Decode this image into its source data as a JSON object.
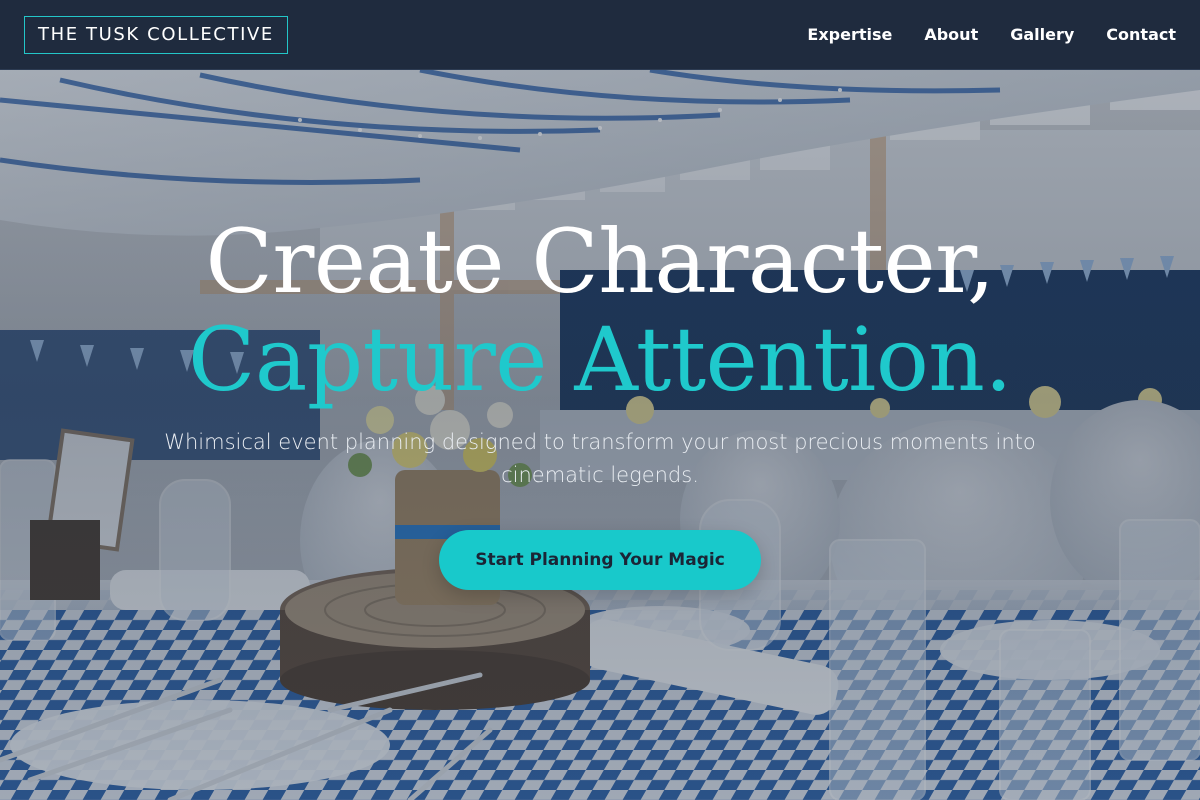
{
  "nav": {
    "brand": "THE TUSK COLLECTIVE",
    "links": [
      "Expertise",
      "About",
      "Gallery",
      "Contact"
    ]
  },
  "hero": {
    "headline_line1": "Create Character,",
    "headline_line2": "Capture Attention.",
    "subtitle": "Whimsical event planning designed to transform your most precious moments into cinematic legends.",
    "cta_label": "Start Planning Your Magic",
    "background_image": "decorated-banquet-hall-photo"
  },
  "colors": {
    "nav_background": "#1f2b3e",
    "accent": "#1fc9cc",
    "cta_text": "#1b2536",
    "headline_white": "#ffffff"
  }
}
